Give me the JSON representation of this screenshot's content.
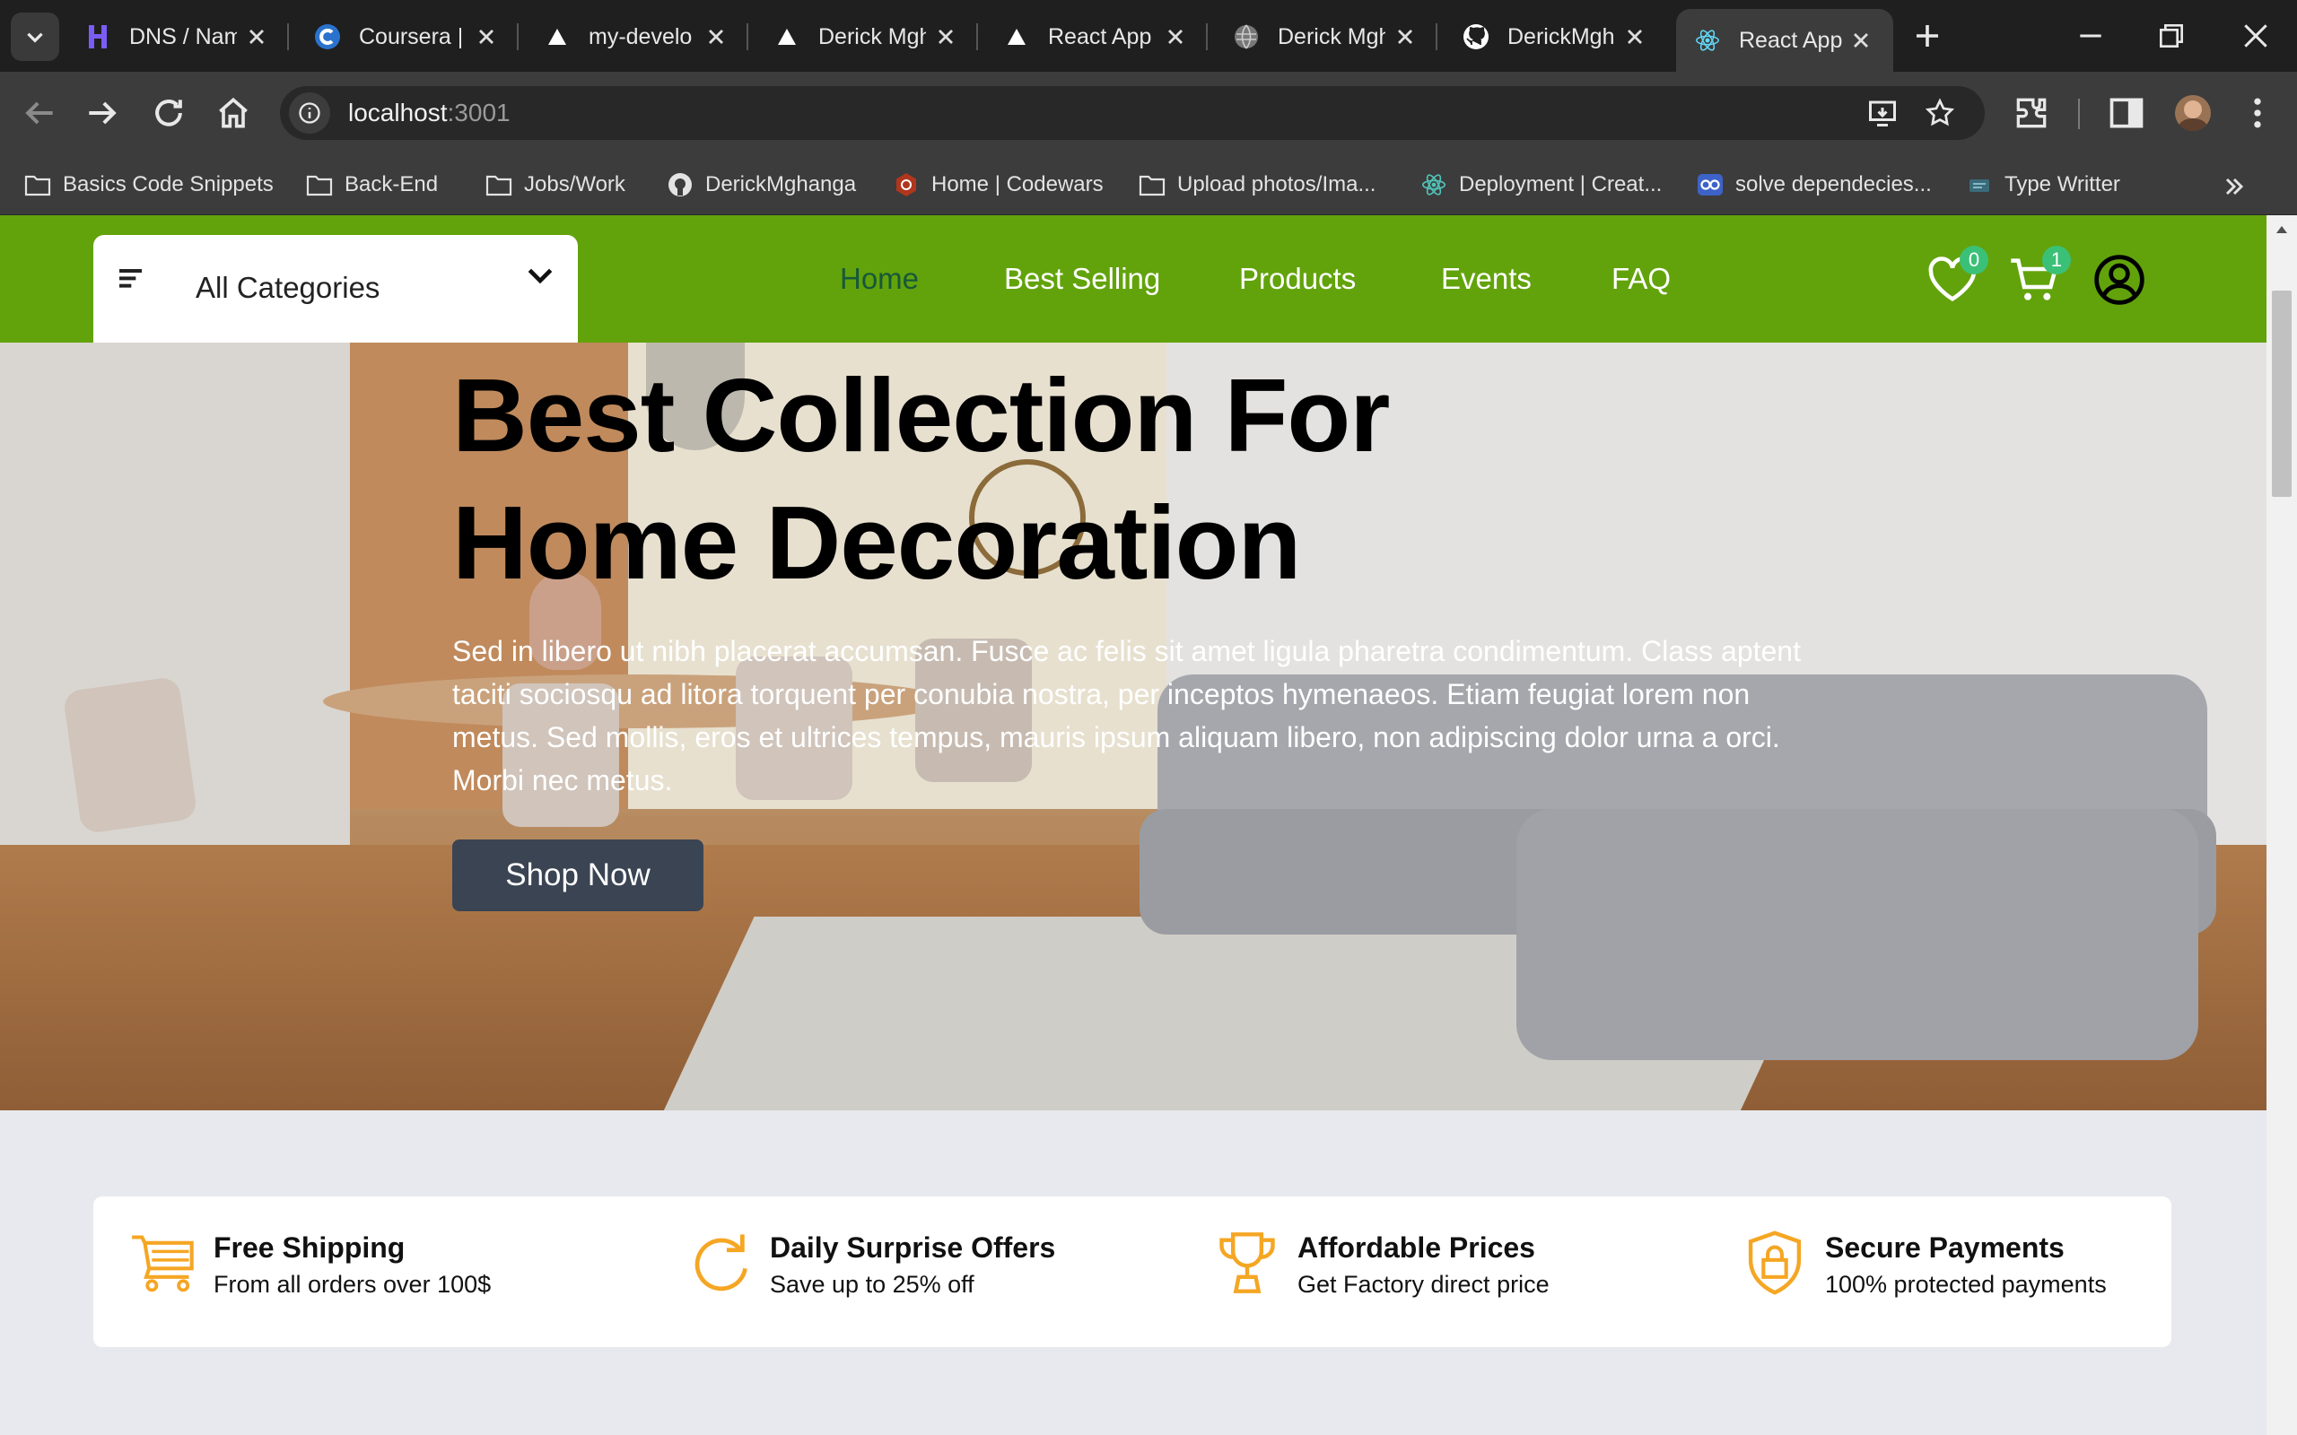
{
  "browser": {
    "tabs": [
      {
        "title": "DNS / Nam",
        "icon": "hostinger-icon"
      },
      {
        "title": "Coursera |",
        "icon": "coursera-icon"
      },
      {
        "title": "my-develo",
        "icon": "vercel-icon"
      },
      {
        "title": "Derick Mgh",
        "icon": "vercel-icon"
      },
      {
        "title": "React App",
        "icon": "vercel-icon"
      },
      {
        "title": "Derick Mgh",
        "icon": "globe-icon"
      },
      {
        "title": "DerickMgh",
        "icon": "github-icon"
      },
      {
        "title": "React App",
        "icon": "react-icon",
        "active": true
      }
    ],
    "url_host": "localhost",
    "url_port": ":3001",
    "bookmarks": [
      {
        "label": "Basics Code Snippets",
        "icon": "folder-icon"
      },
      {
        "label": "Back-End",
        "icon": "folder-icon"
      },
      {
        "label": "Jobs/Work",
        "icon": "folder-icon"
      },
      {
        "label": "DerickMghanga",
        "icon": "github-icon"
      },
      {
        "label": "Home | Codewars",
        "icon": "codewars-icon"
      },
      {
        "label": "Upload photos/Ima...",
        "icon": "folder-icon"
      },
      {
        "label": "Deployment | Creat...",
        "icon": "react-icon"
      },
      {
        "label": "solve dependecies...",
        "icon": "copilot-icon"
      },
      {
        "label": "Type Writter",
        "icon": "typewriter-icon"
      }
    ]
  },
  "header": {
    "categories_label": "All Categories",
    "nav": [
      "Home",
      "Best Selling",
      "Products",
      "Events",
      "FAQ"
    ],
    "active_nav": "Home",
    "wishlist_count": "0",
    "cart_count": "1",
    "brand_color": "#62a30b"
  },
  "hero": {
    "title_line1": "Best Collection For",
    "title_line2": "Home Decoration",
    "text": "Sed in libero ut nibh placerat accumsan. Fusce ac felis sit amet ligula pharetra condimentum. Class aptent taciti sociosqu ad litora torquent per conubia nostra, per inceptos hymenaeos. Etiam feugiat lorem non metus. Sed mollis, eros et ultrices tempus, mauris ipsum aliquam libero, non adipiscing dolor urna a orci. Morbi nec metus.",
    "button": "Shop Now"
  },
  "features": [
    {
      "title": "Free Shipping",
      "subtitle": "From all orders over 100$",
      "icon": "cart-icon"
    },
    {
      "title": "Daily Surprise Offers",
      "subtitle": "Save up to 25% off",
      "icon": "refresh-icon"
    },
    {
      "title": "Affordable Prices",
      "subtitle": "Get Factory direct price",
      "icon": "trophy-icon"
    },
    {
      "title": "Secure Payments",
      "subtitle": "100% protected payments",
      "icon": "shield-lock-icon"
    }
  ],
  "accent_color": "#f5a623"
}
